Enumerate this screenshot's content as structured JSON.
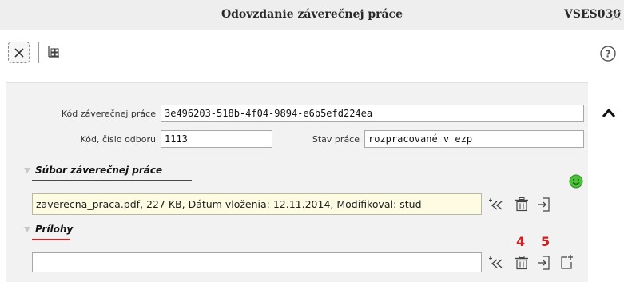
{
  "window": {
    "title": "Odovzdanie záverečnej práce",
    "app_code": "VSES030"
  },
  "icons": {
    "window_close": "close-x-icon",
    "close": "close-box-icon",
    "hierarchy": "hierarchy-icon",
    "help": "help-circle-icon",
    "scroll_up": "chevron-up-icon",
    "status": "green-smiley-icon",
    "fetch": "fetch-arrows-icon",
    "delete": "trash-icon",
    "export": "document-export-icon",
    "new": "new-document-icon"
  },
  "form": {
    "thesis_code_label": "Kód záverečnej práce",
    "thesis_code_value": "3e496203-518b-4f04-9894-e6b5efd224ea",
    "dept_code_label": "Kód, číslo odboru",
    "dept_code_value": "1113",
    "status_label": "Stav práce",
    "status_value": "rozpracované v ezp"
  },
  "file_section": {
    "title": "Súbor záverečnej práce",
    "file_info": "zaverecna_praca.pdf, 227 KB, Dátum vloženia: 12.11.2014, Modifikoval: stud"
  },
  "attachments_section": {
    "title": "Prílohy",
    "value": "",
    "badge_delete": "4",
    "badge_export": "5"
  },
  "colors": {
    "accent_red": "#d42020",
    "file_field_bg": "#fdfbe2",
    "status_green": "#4cc23a"
  }
}
